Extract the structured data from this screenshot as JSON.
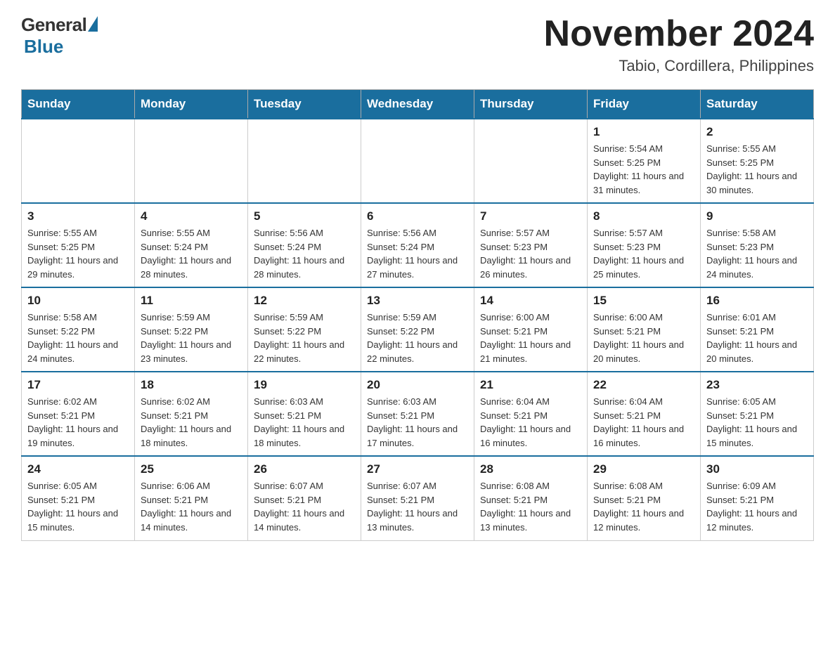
{
  "logo": {
    "general": "General",
    "blue": "Blue"
  },
  "header": {
    "title": "November 2024",
    "subtitle": "Tabio, Cordillera, Philippines"
  },
  "days_of_week": [
    "Sunday",
    "Monday",
    "Tuesday",
    "Wednesday",
    "Thursday",
    "Friday",
    "Saturday"
  ],
  "weeks": [
    [
      {
        "day": "",
        "info": ""
      },
      {
        "day": "",
        "info": ""
      },
      {
        "day": "",
        "info": ""
      },
      {
        "day": "",
        "info": ""
      },
      {
        "day": "",
        "info": ""
      },
      {
        "day": "1",
        "info": "Sunrise: 5:54 AM\nSunset: 5:25 PM\nDaylight: 11 hours and 31 minutes."
      },
      {
        "day": "2",
        "info": "Sunrise: 5:55 AM\nSunset: 5:25 PM\nDaylight: 11 hours and 30 minutes."
      }
    ],
    [
      {
        "day": "3",
        "info": "Sunrise: 5:55 AM\nSunset: 5:25 PM\nDaylight: 11 hours and 29 minutes."
      },
      {
        "day": "4",
        "info": "Sunrise: 5:55 AM\nSunset: 5:24 PM\nDaylight: 11 hours and 28 minutes."
      },
      {
        "day": "5",
        "info": "Sunrise: 5:56 AM\nSunset: 5:24 PM\nDaylight: 11 hours and 28 minutes."
      },
      {
        "day": "6",
        "info": "Sunrise: 5:56 AM\nSunset: 5:24 PM\nDaylight: 11 hours and 27 minutes."
      },
      {
        "day": "7",
        "info": "Sunrise: 5:57 AM\nSunset: 5:23 PM\nDaylight: 11 hours and 26 minutes."
      },
      {
        "day": "8",
        "info": "Sunrise: 5:57 AM\nSunset: 5:23 PM\nDaylight: 11 hours and 25 minutes."
      },
      {
        "day": "9",
        "info": "Sunrise: 5:58 AM\nSunset: 5:23 PM\nDaylight: 11 hours and 24 minutes."
      }
    ],
    [
      {
        "day": "10",
        "info": "Sunrise: 5:58 AM\nSunset: 5:22 PM\nDaylight: 11 hours and 24 minutes."
      },
      {
        "day": "11",
        "info": "Sunrise: 5:59 AM\nSunset: 5:22 PM\nDaylight: 11 hours and 23 minutes."
      },
      {
        "day": "12",
        "info": "Sunrise: 5:59 AM\nSunset: 5:22 PM\nDaylight: 11 hours and 22 minutes."
      },
      {
        "day": "13",
        "info": "Sunrise: 5:59 AM\nSunset: 5:22 PM\nDaylight: 11 hours and 22 minutes."
      },
      {
        "day": "14",
        "info": "Sunrise: 6:00 AM\nSunset: 5:21 PM\nDaylight: 11 hours and 21 minutes."
      },
      {
        "day": "15",
        "info": "Sunrise: 6:00 AM\nSunset: 5:21 PM\nDaylight: 11 hours and 20 minutes."
      },
      {
        "day": "16",
        "info": "Sunrise: 6:01 AM\nSunset: 5:21 PM\nDaylight: 11 hours and 20 minutes."
      }
    ],
    [
      {
        "day": "17",
        "info": "Sunrise: 6:02 AM\nSunset: 5:21 PM\nDaylight: 11 hours and 19 minutes."
      },
      {
        "day": "18",
        "info": "Sunrise: 6:02 AM\nSunset: 5:21 PM\nDaylight: 11 hours and 18 minutes."
      },
      {
        "day": "19",
        "info": "Sunrise: 6:03 AM\nSunset: 5:21 PM\nDaylight: 11 hours and 18 minutes."
      },
      {
        "day": "20",
        "info": "Sunrise: 6:03 AM\nSunset: 5:21 PM\nDaylight: 11 hours and 17 minutes."
      },
      {
        "day": "21",
        "info": "Sunrise: 6:04 AM\nSunset: 5:21 PM\nDaylight: 11 hours and 16 minutes."
      },
      {
        "day": "22",
        "info": "Sunrise: 6:04 AM\nSunset: 5:21 PM\nDaylight: 11 hours and 16 minutes."
      },
      {
        "day": "23",
        "info": "Sunrise: 6:05 AM\nSunset: 5:21 PM\nDaylight: 11 hours and 15 minutes."
      }
    ],
    [
      {
        "day": "24",
        "info": "Sunrise: 6:05 AM\nSunset: 5:21 PM\nDaylight: 11 hours and 15 minutes."
      },
      {
        "day": "25",
        "info": "Sunrise: 6:06 AM\nSunset: 5:21 PM\nDaylight: 11 hours and 14 minutes."
      },
      {
        "day": "26",
        "info": "Sunrise: 6:07 AM\nSunset: 5:21 PM\nDaylight: 11 hours and 14 minutes."
      },
      {
        "day": "27",
        "info": "Sunrise: 6:07 AM\nSunset: 5:21 PM\nDaylight: 11 hours and 13 minutes."
      },
      {
        "day": "28",
        "info": "Sunrise: 6:08 AM\nSunset: 5:21 PM\nDaylight: 11 hours and 13 minutes."
      },
      {
        "day": "29",
        "info": "Sunrise: 6:08 AM\nSunset: 5:21 PM\nDaylight: 11 hours and 12 minutes."
      },
      {
        "day": "30",
        "info": "Sunrise: 6:09 AM\nSunset: 5:21 PM\nDaylight: 11 hours and 12 minutes."
      }
    ]
  ]
}
